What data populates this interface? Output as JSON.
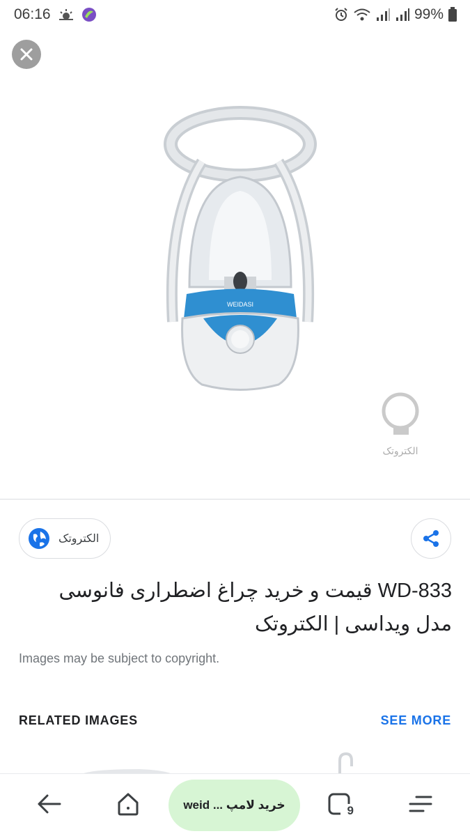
{
  "status_bar": {
    "time": "06:16",
    "battery": "99%",
    "icons": [
      "weather-icon",
      "app-icon",
      "alarm-icon",
      "wifi-icon",
      "signal-icon",
      "signal-icon",
      "battery-icon"
    ]
  },
  "viewer": {
    "close_icon": "close-icon",
    "image_brand_text": "WEIDASI",
    "watermark_text": "الکتروتک"
  },
  "source": {
    "site_name": "الکتروتک",
    "icon": "globe-icon"
  },
  "share": {
    "icon": "share-icon"
  },
  "result": {
    "title": "WD-833 قیمت و خرید چراغ اضطراری فانوسی مدل ویداسی | الکتروتک",
    "copyright_note": "Images may be subject to copyright."
  },
  "related": {
    "label": "RELATED IMAGES",
    "see_more": "SEE MORE"
  },
  "bottom_nav": {
    "back_icon": "back-arrow-icon",
    "home_icon": "home-icon",
    "search_pill_text": "خرید لامپ ... weid",
    "tabs_icon": "tabs-icon",
    "tabs_count": "9",
    "menu_icon": "menu-icon"
  },
  "colors": {
    "accent": "#1a73e8",
    "pill": "#d7f5d4",
    "lantern_blue": "#2f8fd1"
  }
}
